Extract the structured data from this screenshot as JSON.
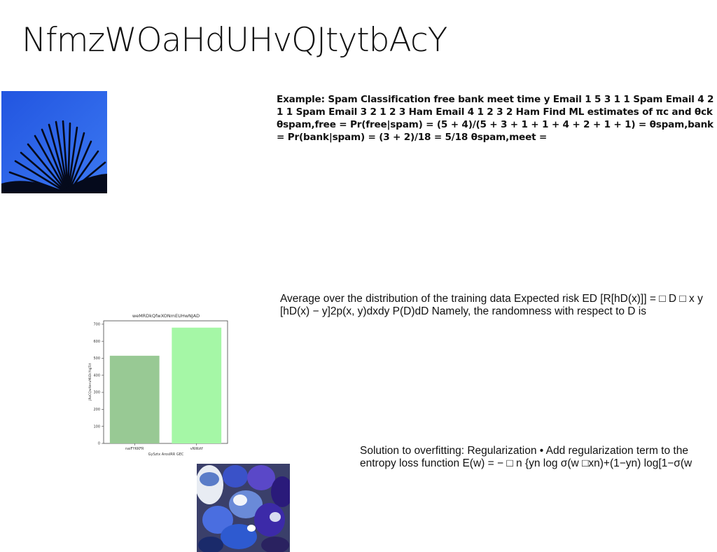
{
  "title": "NfmzWOaHdUHvQJtytbAcY",
  "blocks": {
    "spam_example": "Example: Spam Classification free bank meet time y Email 1 5 3 1 1 Spam Email 4 2 1 1 Spam Email 3 2 1 2 3 Ham Email 4 1 2 3 2 Ham Find ML estimates of πc and θck θspam,free = Pr(free|spam) = (5 + 4)/(5 + 3 + 1 + 1 + 4 + 2 + 1 + 1) = θspam,bank = Pr(bank|spam) = (3 + 2)/18 = 5/18 θspam,meet =",
    "expected_risk": "Average over the distribution of the training data Expected risk ED [R[hD(x)]] = □ D □ x y [hD(x) − y]2p(x, y)dxdy P(D)dD Namely, the randomness with respect to D is",
    "regularization": "Solution to overfitting: Regularization • Add regularization term to the entropy loss function E(w) = − □ n {yn log σ(w □xn)+(1−yn) log[1−σ(w"
  },
  "images": {
    "palm": "palm-leaf-blue-sky-photo",
    "stones": "blue-painted-stones-photo"
  },
  "chart_data": {
    "type": "bar",
    "title": "weMRDkQfwXONmEUHwNJAD",
    "xlabel": "GySztx ArosIRR GEC",
    "ylabel": "jRoCQwNeruMiiDcYqjTct",
    "categories": [
      "naiFYKKFR",
      "vNWztf"
    ],
    "values": [
      515,
      680
    ],
    "colors": [
      "#98c994",
      "#a5f7a6"
    ],
    "ylim": [
      0,
      720
    ],
    "yticks": [
      0,
      100,
      200,
      300,
      400,
      500,
      600,
      700
    ],
    "grid": false
  }
}
